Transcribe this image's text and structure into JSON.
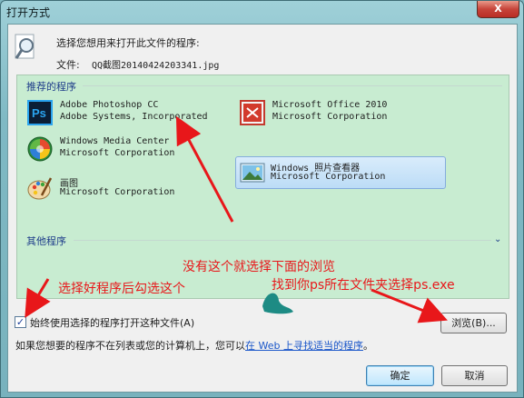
{
  "window": {
    "title": "打开方式",
    "close_label": "X"
  },
  "header": {
    "prompt": "选择您想用来打开此文件的程序:",
    "file_label": "文件:",
    "file_name": "QQ截图20140424203341.jpg"
  },
  "recommended": {
    "header": "推荐的程序",
    "programs": [
      {
        "name": "Adobe Photoshop CC",
        "vendor": "Adobe Systems, Incorporated",
        "icon": "photoshop-icon",
        "selected": false
      },
      {
        "name": "Microsoft Office 2010",
        "vendor": "Microsoft Corporation",
        "icon": "office-icon",
        "selected": false
      },
      {
        "name": "Windows Media Center",
        "vendor": "Microsoft Corporation",
        "icon": "media-center-icon",
        "selected": false
      },
      {
        "name": "Windows 照片查看器",
        "vendor": "Microsoft Corporation",
        "icon": "photo-viewer-icon",
        "selected": true
      },
      {
        "name": "画图",
        "vendor": "Microsoft Corporation",
        "icon": "paint-icon",
        "selected": false
      }
    ]
  },
  "other": {
    "header": "其他程序",
    "expand_icon": "chevron-down-icon"
  },
  "annotations": {
    "no_program": "没有这个就选择下面的浏览",
    "check_after": "选择好程序后勾选这个",
    "find_ps": "找到你ps所在文件夹选择ps.exe"
  },
  "always_use": {
    "label": "始终使用选择的程序打开这种文件(A)",
    "checked": true
  },
  "buttons": {
    "browse": "浏览(B)...",
    "ok": "确定",
    "cancel": "取消"
  },
  "footer": {
    "text": "如果您想要的程序不在列表或您的计算机上，您可以",
    "link": "在 Web 上寻找适当的程序",
    "suffix": "。"
  },
  "colors": {
    "annotation": "#e8171a",
    "list_bg": "#c8ecd1",
    "link": "#1a56c9"
  }
}
